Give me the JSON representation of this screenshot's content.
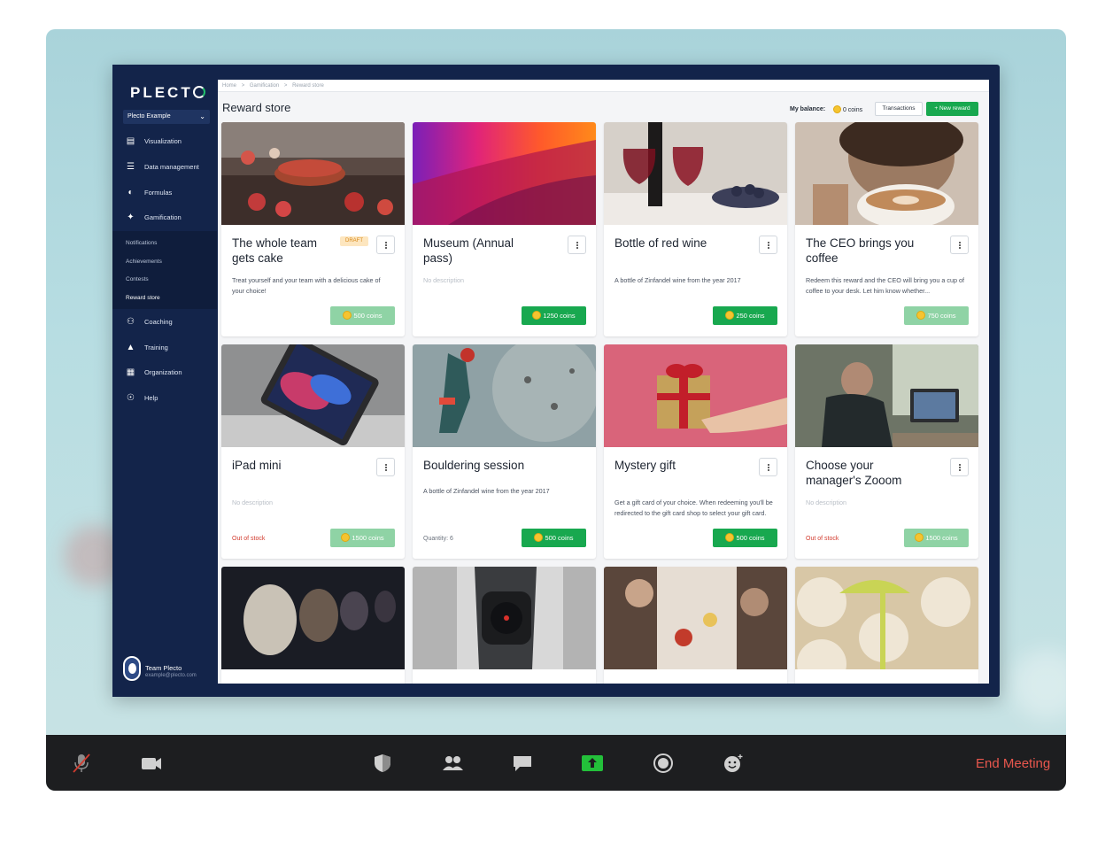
{
  "app": {
    "logo": "PLECTO",
    "org": "Plecto Example"
  },
  "sidebar": {
    "items": [
      {
        "label": "Visualization",
        "icon": "bar-chart-icon"
      },
      {
        "label": "Data management",
        "icon": "database-icon"
      },
      {
        "label": "Formulas",
        "icon": "gauge-icon"
      },
      {
        "label": "Gamification",
        "icon": "gamepad-icon"
      },
      {
        "label": "Coaching",
        "icon": "people-icon"
      },
      {
        "label": "Training",
        "icon": "graduation-cap-icon"
      },
      {
        "label": "Organization",
        "icon": "building-icon"
      },
      {
        "label": "Help",
        "icon": "lifebuoy-icon"
      }
    ],
    "subitems": [
      "Notifications",
      "Achievements",
      "Contests",
      "Reward store"
    ],
    "active_sub": "Reward store",
    "user": {
      "name": "Team Plecto",
      "email": "example@plecto.com"
    }
  },
  "breadcrumb": [
    "Home",
    ">",
    "Gamification",
    ">",
    "Reward store"
  ],
  "header": {
    "title": "Reward store",
    "balance_label": "My balance:",
    "balance_value": "0 coins",
    "transactions_label": "Transactions",
    "new_reward_label": "+ New reward"
  },
  "cards": [
    {
      "title": "The whole team gets cake",
      "badge": "DRAFT",
      "desc": "Treat yourself and your team with a delicious cake of your choice!",
      "price": "500 coins",
      "faded": true,
      "footer": ""
    },
    {
      "title": "Museum (Annual pass)",
      "desc": "No description",
      "muted": true,
      "price": "1250 coins",
      "faded": false,
      "footer": ""
    },
    {
      "title": "Bottle of red wine",
      "desc": "A bottle of Zinfandel wine from the year 2017",
      "price": "250 coins",
      "faded": false,
      "footer": ""
    },
    {
      "title": "The CEO brings you coffee",
      "desc": "Redeem this reward and the CEO will bring you a cup of coffee to your desk. Let him know whether...",
      "price": "750 coins",
      "faded": true,
      "footer": ""
    },
    {
      "title": "iPad mini",
      "desc": "No description",
      "muted": true,
      "price": "1500 coins",
      "faded": true,
      "footer": "Out of stock",
      "footer_type": "stock"
    },
    {
      "title": "Bouldering session",
      "desc": "A bottle of Zinfandel wine from the year 2017",
      "price": "500 coins",
      "faded": false,
      "footer": "Quantity: 6",
      "footer_type": "qty"
    },
    {
      "title": "Mystery gift",
      "desc": "Get a gift card of your choice. When redeeming you'll be redirected to the gift card shop to select your gift card.",
      "price": "500 coins",
      "faded": false,
      "footer": ""
    },
    {
      "title": "Choose your manager's Zooom",
      "desc": "No description",
      "muted": true,
      "price": "1500 coins",
      "faded": true,
      "footer": "Out of stock",
      "footer_type": "stock"
    }
  ],
  "meeting_bar": {
    "end_label": "End Meeting"
  }
}
